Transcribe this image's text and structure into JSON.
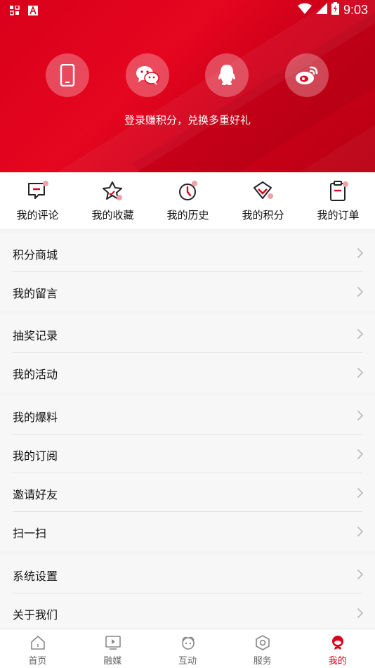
{
  "status_bar": {
    "time": "9:03"
  },
  "header": {
    "login_prompt": "登录赚积分，兑换多重好礼",
    "social_logins": [
      {
        "icon": "phone-icon"
      },
      {
        "icon": "wechat-icon"
      },
      {
        "icon": "qq-icon"
      },
      {
        "icon": "weibo-icon"
      }
    ]
  },
  "quick_actions": [
    {
      "label": "我的评论",
      "icon": "comment-icon"
    },
    {
      "label": "我的收藏",
      "icon": "star-icon"
    },
    {
      "label": "我的历史",
      "icon": "clock-icon"
    },
    {
      "label": "我的积分",
      "icon": "points-icon"
    },
    {
      "label": "我的订单",
      "icon": "order-icon"
    }
  ],
  "menu_groups": [
    [
      "积分商城",
      "我的留言"
    ],
    [
      "抽奖记录",
      "我的活动"
    ],
    [
      "我的爆料",
      "我的订阅",
      "邀请好友",
      "扫一扫"
    ],
    [
      "系统设置",
      "关于我们"
    ]
  ],
  "tab_bar": [
    {
      "label": "首页",
      "icon": "home-icon"
    },
    {
      "label": "融媒",
      "icon": "media-icon"
    },
    {
      "label": "互动",
      "icon": "interact-icon"
    },
    {
      "label": "服务",
      "icon": "service-icon"
    },
    {
      "label": "我的",
      "icon": "profile-icon",
      "active": true
    }
  ],
  "colors": {
    "brand_red": "#d9001b",
    "accent_dot": "#f0a0a8"
  }
}
